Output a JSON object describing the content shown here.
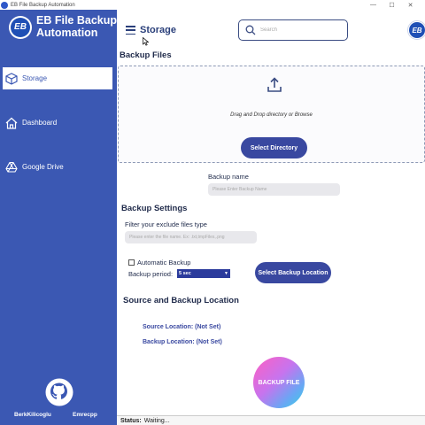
{
  "window": {
    "title": "EB File Backup Automation",
    "controls": [
      "—",
      "☐",
      "✕"
    ]
  },
  "brand": {
    "name": "EB File Backup Automation",
    "logo_text": "EB"
  },
  "sidebar": {
    "items": [
      {
        "label": "Storage",
        "icon": "cube-icon",
        "active": true
      },
      {
        "label": "Dashboard",
        "icon": "home-icon",
        "active": false
      },
      {
        "label": "Google Drive",
        "icon": "google-drive-icon",
        "active": false
      }
    ],
    "authors": [
      "BerkKilicoglu",
      "Emrecpp"
    ]
  },
  "header": {
    "title": "Storage",
    "search_placeholder": "Search"
  },
  "backup_files": {
    "heading": "Backup Files",
    "drop_text": "Drag and Drop directory or Browse",
    "select_directory_label": "Select Directory",
    "name_label": "Backup name",
    "name_placeholder": "Please Enter Backup Name"
  },
  "backup_settings": {
    "heading": "Backup Settings",
    "filter_label": "Filter your exclude files type",
    "filter_placeholder": "Please enter the file name. Ex: .txt,tmpFiles,.png",
    "auto_backup_label": "Automatic Backup",
    "auto_backup_checked": false,
    "period_label": "Backup period:",
    "period_value": "5 sec",
    "select_location_label": "Select Backup Location"
  },
  "locations": {
    "heading": "Source and Backup Location",
    "source": "Source Location: (Not Set)",
    "backup": "Backup Location: (Not Set)"
  },
  "backup_button_label": "BACKUP FILE",
  "status": {
    "label": "Status:",
    "value": "Waiting..."
  },
  "colors": {
    "sidebar": "#3b58b3",
    "accent": "#3948a0",
    "dropzone_border": "#8e9ab6"
  }
}
